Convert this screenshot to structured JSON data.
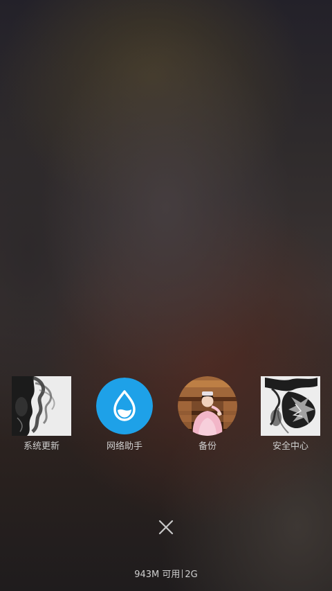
{
  "recent_apps": [
    {
      "label": "系统更新",
      "icon": "ink-art-wallpaper-icon",
      "thumb_style": "square"
    },
    {
      "label": "网络助手",
      "icon": "water-drop-icon",
      "thumb_style": "circle",
      "color": "#1ea1e8"
    },
    {
      "label": "备份",
      "icon": "photo-avatar-icon",
      "thumb_style": "circle"
    },
    {
      "label": "安全中心",
      "icon": "ink-splash-art-icon",
      "thumb_style": "square"
    }
  ],
  "close_button": {
    "icon": "close-icon",
    "color": "#c8c8c8"
  },
  "memory_status": {
    "available": "943M 可用",
    "total": "2G"
  }
}
